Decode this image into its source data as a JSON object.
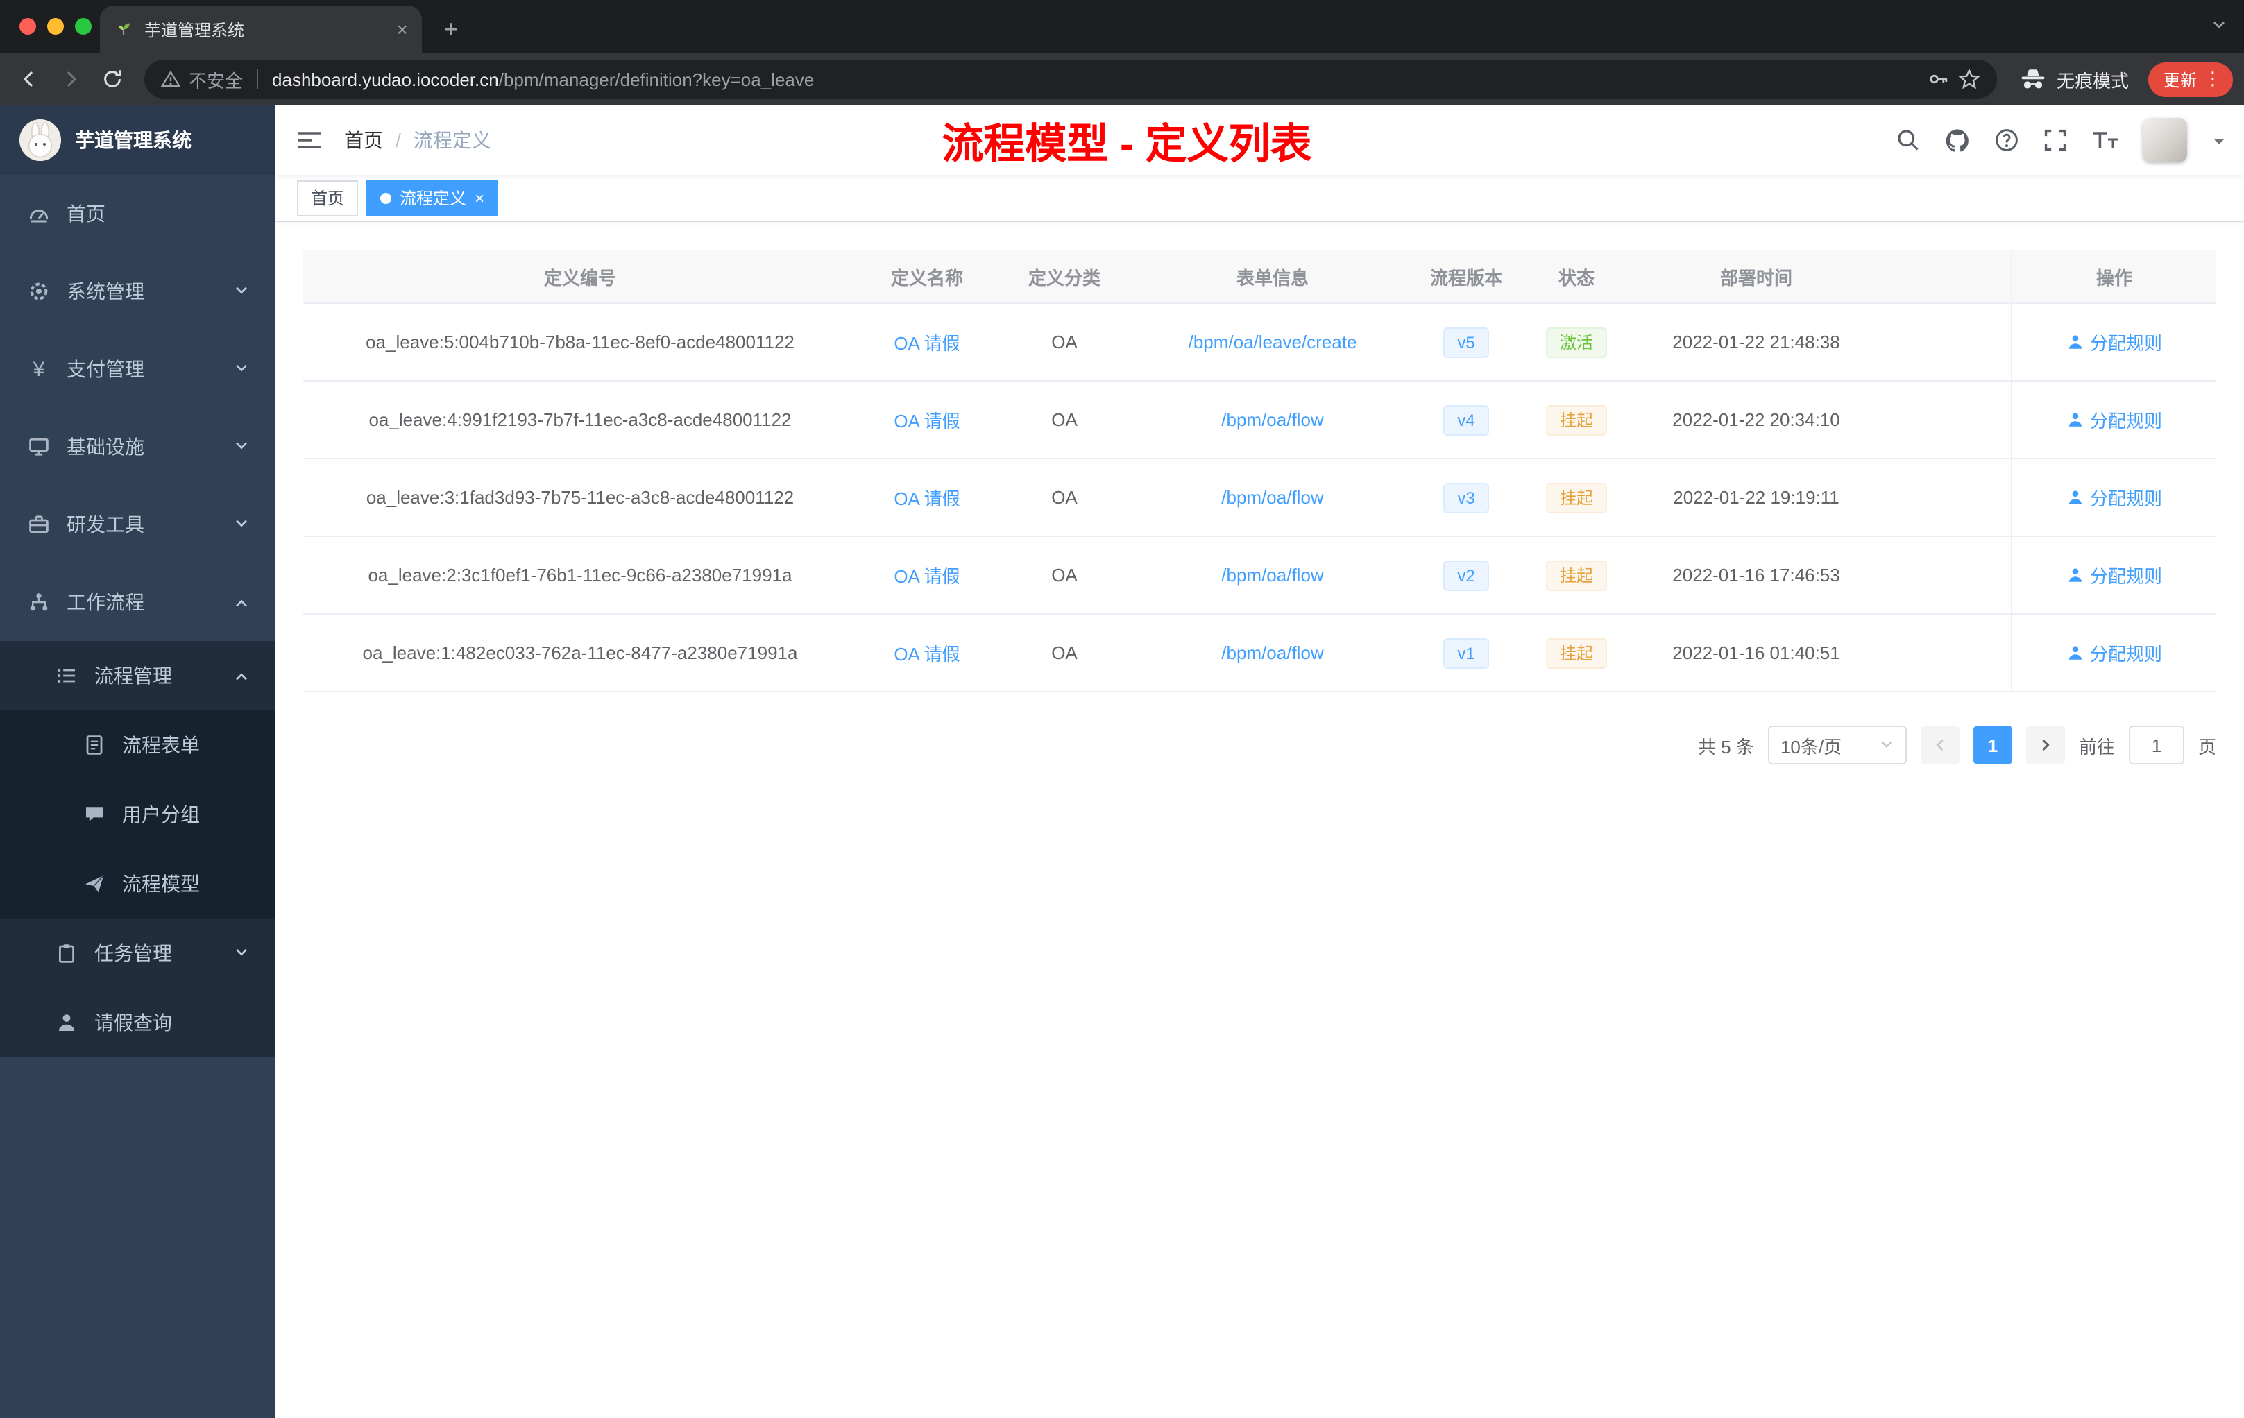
{
  "browser": {
    "tab_title": "芋道管理系统",
    "security_label": "不安全",
    "url_domain": "dashboard.yudao.iocoder.cn",
    "url_path": "/bpm/manager/definition?key=oa_leave",
    "incognito_label": "无痕模式",
    "update_label": "更新"
  },
  "icons": {
    "yen": "¥",
    "close": "×",
    "plus": "+",
    "dots": "⋮"
  },
  "sidebar": {
    "logo_title": "芋道管理系统",
    "items": [
      {
        "label": "首页"
      },
      {
        "label": "系统管理"
      },
      {
        "label": "支付管理"
      },
      {
        "label": "基础设施"
      },
      {
        "label": "研发工具"
      },
      {
        "label": "工作流程"
      },
      {
        "label": "流程管理"
      },
      {
        "label": "流程表单"
      },
      {
        "label": "用户分组"
      },
      {
        "label": "流程模型"
      },
      {
        "label": "任务管理"
      },
      {
        "label": "请假查询"
      }
    ]
  },
  "header": {
    "breadcrumb": [
      "首页",
      "流程定义"
    ],
    "breadcrumb_separator": "/",
    "annotation": "流程模型 - 定义列表"
  },
  "tags": [
    {
      "label": "首页",
      "active": false
    },
    {
      "label": "流程定义",
      "active": true
    }
  ],
  "table": {
    "headers": [
      "定义编号",
      "定义名称",
      "定义分类",
      "表单信息",
      "流程版本",
      "状态",
      "部署时间",
      "操作"
    ],
    "action_label": "分配规则",
    "rows": [
      {
        "id": "oa_leave:5:004b710b-7b8a-11ec-8ef0-acde48001122",
        "name": "OA 请假",
        "category": "OA",
        "form": "/bpm/oa/leave/create",
        "version": "v5",
        "status": "激活",
        "time": "2022-01-22 21:48:38"
      },
      {
        "id": "oa_leave:4:991f2193-7b7f-11ec-a3c8-acde48001122",
        "name": "OA 请假",
        "category": "OA",
        "form": "/bpm/oa/flow",
        "version": "v4",
        "status": "挂起",
        "time": "2022-01-22 20:34:10"
      },
      {
        "id": "oa_leave:3:1fad3d93-7b75-11ec-a3c8-acde48001122",
        "name": "OA 请假",
        "category": "OA",
        "form": "/bpm/oa/flow",
        "version": "v3",
        "status": "挂起",
        "time": "2022-01-22 19:19:11"
      },
      {
        "id": "oa_leave:2:3c1f0ef1-76b1-11ec-9c66-a2380e71991a",
        "name": "OA 请假",
        "category": "OA",
        "form": "/bpm/oa/flow",
        "version": "v2",
        "status": "挂起",
        "time": "2022-01-16 17:46:53"
      },
      {
        "id": "oa_leave:1:482ec033-762a-11ec-8477-a2380e71991a",
        "name": "OA 请假",
        "category": "OA",
        "form": "/bpm/oa/flow",
        "version": "v1",
        "status": "挂起",
        "time": "2022-01-16 01:40:51"
      }
    ]
  },
  "pagination": {
    "total": "共 5 条",
    "page_size": "10条/页",
    "current_page": "1",
    "goto_label": "前往",
    "goto_value": "1",
    "goto_unit": "页"
  },
  "colors": {
    "accent_blue": "#409eff",
    "annotation_red": "#fe0000",
    "success_green": "#67c23a",
    "warning_orange": "#e6a23c",
    "sidebar_bg": "#304156",
    "sidebar_sub_bg": "#1f2d3d"
  }
}
